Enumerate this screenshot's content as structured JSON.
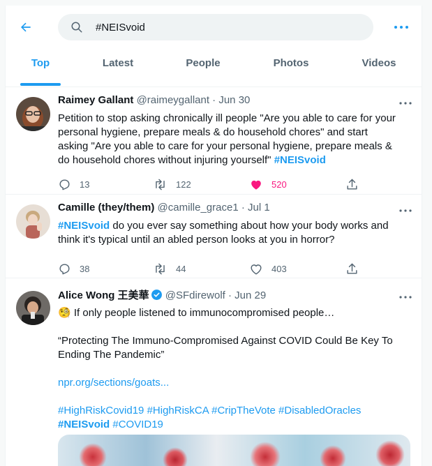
{
  "search": {
    "value": "#NEISvoid"
  },
  "tabs": [
    {
      "label": "Top",
      "active": true
    },
    {
      "label": "Latest",
      "active": false
    },
    {
      "label": "People",
      "active": false
    },
    {
      "label": "Photos",
      "active": false
    },
    {
      "label": "Videos",
      "active": false
    }
  ],
  "tweets": [
    {
      "name": "Raimey Gallant",
      "handle": "@raimeygallant",
      "date": "Jun 30",
      "text_before": "Petition to stop asking chronically ill people \"Are you able to care for your personal hygiene, prepare meals & do household chores\" and start asking \"Are you able to care for your personal hygiene, prepare meals & do household chores without injuring yourself\" ",
      "hashtag": "#NEISvoid",
      "replies": "13",
      "retweets": "122",
      "likes": "520",
      "liked": true
    },
    {
      "name": "Camille (they/them)",
      "handle": "@camille_grace1",
      "date": "Jul 1",
      "hashtag": "#NEISvoid",
      "text_after": " do you ever say something about how your body works and think it's typical until an abled person looks at you in horror?",
      "replies": "38",
      "retweets": "44",
      "likes": "403",
      "liked": false
    },
    {
      "name": "Alice Wong 王美華",
      "verified": true,
      "handle": "@SFdirewolf",
      "date": "Jun 29",
      "emoji": "🧐",
      "line1": " If only people listened to immunocompromised people…",
      "quote": "“Protecting The Immuno-Compromised Against COVID Could Be Key To Ending The Pandemic”",
      "link": "npr.org/sections/goats...",
      "hashtags": [
        "#HighRiskCovid19",
        "#HighRiskCA",
        "#CripTheVote",
        "#DisabledOracles",
        "#NEISvoid",
        "#COVID19"
      ]
    }
  ],
  "colors": {
    "accent": "#1d9bf0",
    "like": "#f91880",
    "secondary_text": "#536471"
  },
  "icons": [
    "back-arrow-icon",
    "search-icon",
    "more-icon",
    "reply-icon",
    "retweet-icon",
    "like-icon",
    "share-icon",
    "verified-badge-icon"
  ]
}
